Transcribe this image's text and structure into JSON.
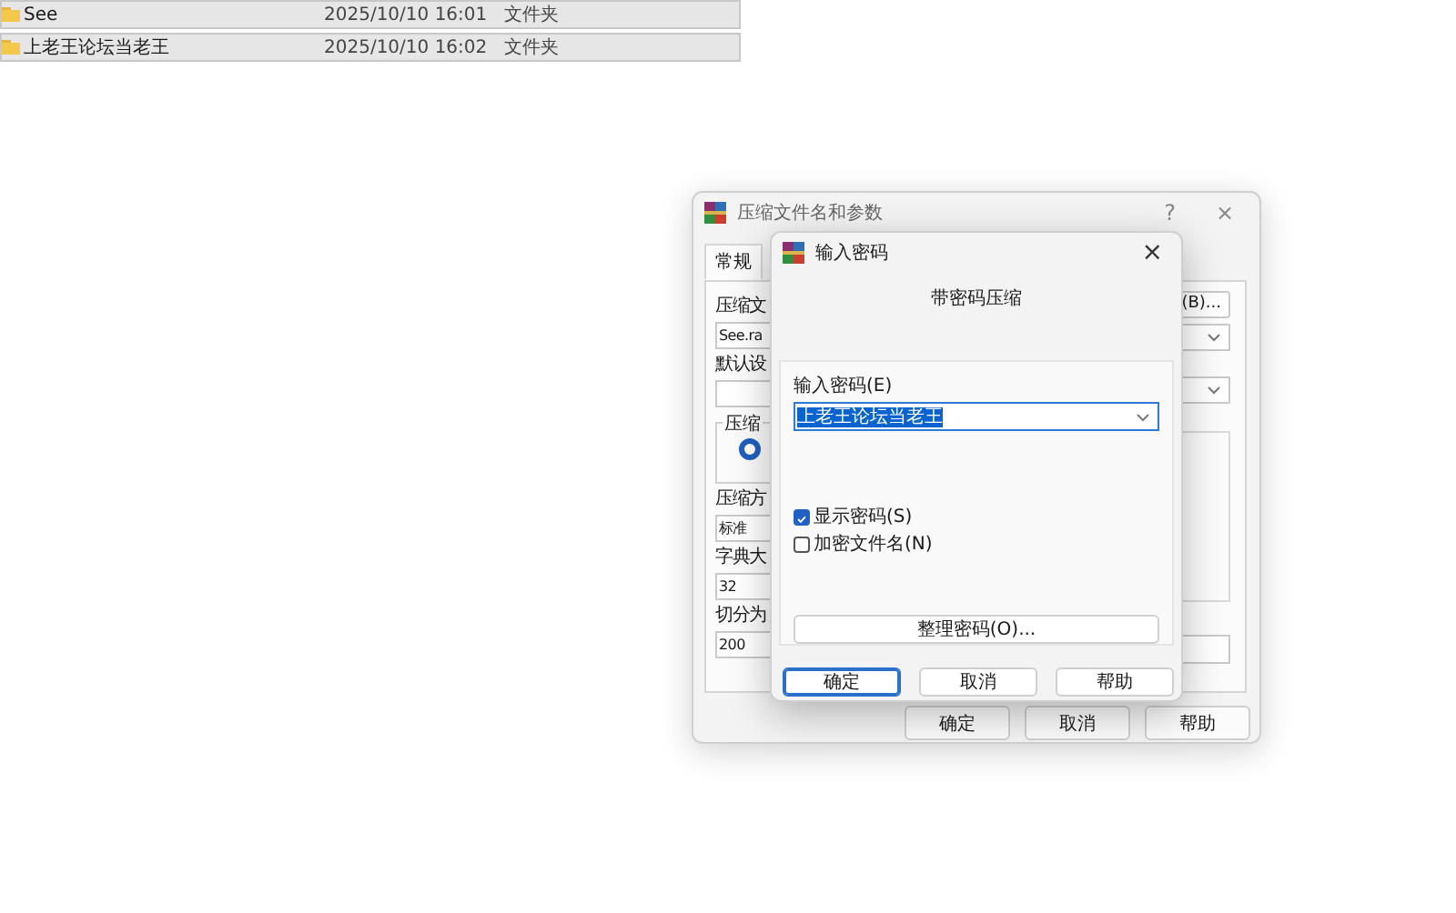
{
  "file_list": {
    "rows": [
      {
        "name": "See",
        "date": "2025/10/10 16:01",
        "type": "文件夹"
      },
      {
        "name": "上老王论坛当老王",
        "date": "2025/10/10 16:02",
        "type": "文件夹"
      }
    ]
  },
  "back_dialog": {
    "title": "压缩文件名和参数",
    "help": "?",
    "close": "×",
    "tabs": [
      {
        "label": "常规",
        "selected": true
      }
    ],
    "left_items": [
      {
        "kind": "label",
        "text": "压缩文"
      },
      {
        "kind": "field",
        "value": "See.ra"
      },
      {
        "kind": "label",
        "text": "默认设"
      },
      {
        "kind": "field"
      },
      {
        "kind": "group",
        "text": "压缩",
        "radio_selected": true
      },
      {
        "kind": "label",
        "text": "压缩方"
      },
      {
        "kind": "field",
        "value": "标准"
      },
      {
        "kind": "label",
        "text": "字典大"
      },
      {
        "kind": "field",
        "value": "32"
      },
      {
        "kind": "label",
        "text": "切分为"
      },
      {
        "kind": "field",
        "value": "200"
      }
    ],
    "browse_button": "(B)...",
    "buttons": [
      {
        "label": "确定"
      },
      {
        "label": "取消"
      },
      {
        "label": "帮助"
      }
    ]
  },
  "password_dialog": {
    "title": "输入密码",
    "close": "×",
    "heading": "带密码压缩",
    "password_label": "输入密码(E)",
    "password": "上老王论坛当老王",
    "password_selected": true,
    "checkboxes": [
      {
        "label": "显示密码(S)",
        "checked": true
      },
      {
        "label": "加密文件名(N)",
        "checked": false
      }
    ],
    "manage_button": "整理密码(O)...",
    "buttons": [
      {
        "label": "确定",
        "default": true
      },
      {
        "label": "取消",
        "default": false
      },
      {
        "label": "帮助",
        "default": false
      }
    ]
  }
}
